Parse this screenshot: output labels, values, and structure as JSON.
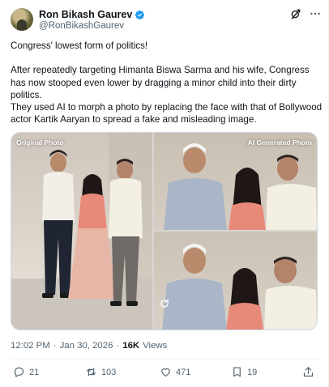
{
  "author": {
    "display_name": "Ron Bikash Gaurev",
    "handle": "@RonBikashGaurev",
    "verified_color": "#1d9bf0"
  },
  "tweet": {
    "lines": [
      "Congress' lowest form of politics!",
      "",
      "After repeatedly targeting Himanta Biswa Sarma and his wife, Congress has now stooped even lower by dragging a minor child into their dirty politics.",
      "They used AI to morph a photo by replacing the face with that of Bollywood actor Kartik Aaryan to spread a fake and misleading image."
    ]
  },
  "media": {
    "left_label": "Original Photo",
    "right_label": "AI Generated Photo"
  },
  "meta": {
    "time": "12:02 PM",
    "separator": "·",
    "date": "Jan 30, 2026",
    "views_count": "16K",
    "views_label": "Views"
  },
  "actions": {
    "replies": "21",
    "reposts": "103",
    "likes": "471",
    "bookmarks": "19"
  },
  "icons": [
    "verified-badge-icon",
    "grok-icon",
    "more-icon",
    "reply-icon",
    "repost-icon",
    "like-icon",
    "bookmark-icon",
    "share-icon",
    "refresh-icon"
  ],
  "colors": {
    "text": "#0f1419",
    "secondary": "#536471",
    "accent": "#1d9bf0"
  }
}
